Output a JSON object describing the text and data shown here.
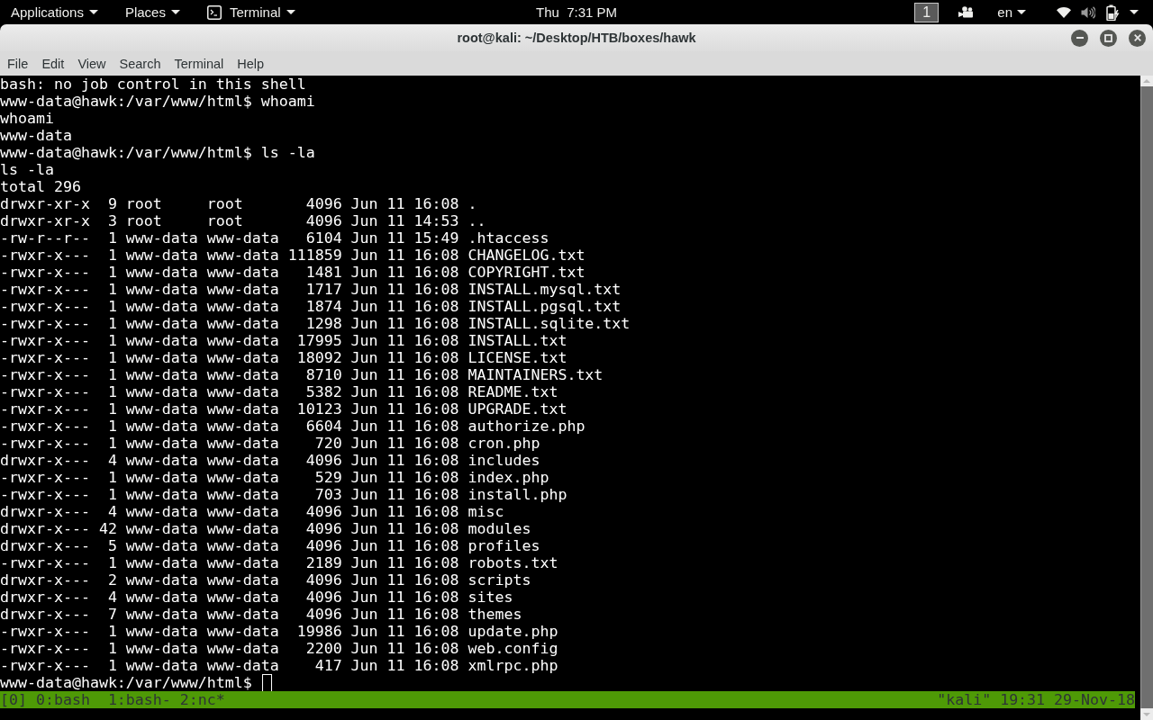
{
  "top_bar": {
    "menus": [
      {
        "label": "Applications",
        "kind": "menu"
      },
      {
        "label": "Places",
        "kind": "menu"
      },
      {
        "label": "Terminal",
        "kind": "app"
      }
    ],
    "clock": "Thu  7:31 PM",
    "workspace": "1",
    "keyboard_layout": "en"
  },
  "window": {
    "title": "root@kali: ~/Desktop/HTB/boxes/hawk",
    "menu": [
      "File",
      "Edit",
      "View",
      "Search",
      "Terminal",
      "Help"
    ]
  },
  "terminal": {
    "lines": [
      "bash: no job control in this shell",
      "www-data@hawk:/var/www/html$ whoami",
      "whoami",
      "www-data",
      "www-data@hawk:/var/www/html$ ls -la",
      "ls -la",
      "total 296",
      "drwxr-xr-x  9 root     root       4096 Jun 11 16:08 .",
      "drwxr-xr-x  3 root     root       4096 Jun 11 14:53 ..",
      "-rw-r--r--  1 www-data www-data   6104 Jun 11 15:49 .htaccess",
      "-rwxr-x---  1 www-data www-data 111859 Jun 11 16:08 CHANGELOG.txt",
      "-rwxr-x---  1 www-data www-data   1481 Jun 11 16:08 COPYRIGHT.txt",
      "-rwxr-x---  1 www-data www-data   1717 Jun 11 16:08 INSTALL.mysql.txt",
      "-rwxr-x---  1 www-data www-data   1874 Jun 11 16:08 INSTALL.pgsql.txt",
      "-rwxr-x---  1 www-data www-data   1298 Jun 11 16:08 INSTALL.sqlite.txt",
      "-rwxr-x---  1 www-data www-data  17995 Jun 11 16:08 INSTALL.txt",
      "-rwxr-x---  1 www-data www-data  18092 Jun 11 16:08 LICENSE.txt",
      "-rwxr-x---  1 www-data www-data   8710 Jun 11 16:08 MAINTAINERS.txt",
      "-rwxr-x---  1 www-data www-data   5382 Jun 11 16:08 README.txt",
      "-rwxr-x---  1 www-data www-data  10123 Jun 11 16:08 UPGRADE.txt",
      "-rwxr-x---  1 www-data www-data   6604 Jun 11 16:08 authorize.php",
      "-rwxr-x---  1 www-data www-data    720 Jun 11 16:08 cron.php",
      "drwxr-x---  4 www-data www-data   4096 Jun 11 16:08 includes",
      "-rwxr-x---  1 www-data www-data    529 Jun 11 16:08 index.php",
      "-rwxr-x---  1 www-data www-data    703 Jun 11 16:08 install.php",
      "drwxr-x---  4 www-data www-data   4096 Jun 11 16:08 misc",
      "drwxr-x--- 42 www-data www-data   4096 Jun 11 16:08 modules",
      "drwxr-x---  5 www-data www-data   4096 Jun 11 16:08 profiles",
      "-rwxr-x---  1 www-data www-data   2189 Jun 11 16:08 robots.txt",
      "drwxr-x---  2 www-data www-data   4096 Jun 11 16:08 scripts",
      "drwxr-x---  4 www-data www-data   4096 Jun 11 16:08 sites",
      "drwxr-x---  7 www-data www-data   4096 Jun 11 16:08 themes",
      "-rwxr-x---  1 www-data www-data  19986 Jun 11 16:08 update.php",
      "-rwxr-x---  1 www-data www-data   2200 Jun 11 16:08 web.config",
      "-rwxr-x---  1 www-data www-data    417 Jun 11 16:08 xmlrpc.php"
    ],
    "prompt": "www-data@hawk:/var/www/html$"
  },
  "status_bar": {
    "windows": "[0] 0:bash  1:bash- 2:nc*",
    "host_time": "\"kali\" 19:31 29-Nov-18"
  }
}
